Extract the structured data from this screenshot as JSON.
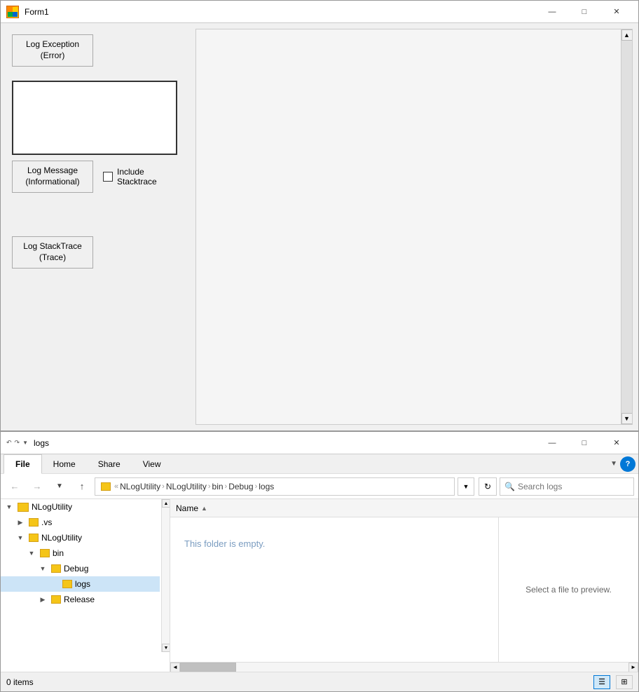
{
  "form1": {
    "title": "Form1",
    "buttons": {
      "log_exception": "Log Exception\n(Error)",
      "log_message": "Log Message\n(Informational)",
      "log_stacktrace": "Log StackTrace\n(Trace)"
    },
    "checkbox": {
      "label": "Include\nStacktrace",
      "checked": false
    },
    "textarea_placeholder": "",
    "window_controls": {
      "minimize": "—",
      "maximize": "□",
      "close": "✕"
    }
  },
  "explorer": {
    "title": "logs",
    "window_controls": {
      "minimize": "—",
      "maximize": "□",
      "close": "✕"
    },
    "ribbon": {
      "tabs": [
        "File",
        "Home",
        "Share",
        "View"
      ],
      "active_tab": "File"
    },
    "address_bar": {
      "path_segments": [
        "NLogUtility",
        "NLogUtility",
        "bin",
        "Debug",
        "logs"
      ],
      "search_placeholder": "Search logs"
    },
    "sidebar": {
      "items": [
        {
          "label": "NLogUtility",
          "level": 0,
          "expanded": true,
          "selected": false
        },
        {
          "label": ".vs",
          "level": 1,
          "expanded": false,
          "selected": false
        },
        {
          "label": "NLogUtility",
          "level": 1,
          "expanded": true,
          "selected": false
        },
        {
          "label": "bin",
          "level": 2,
          "expanded": true,
          "selected": false
        },
        {
          "label": "Debug",
          "level": 3,
          "expanded": true,
          "selected": false
        },
        {
          "label": "logs",
          "level": 4,
          "expanded": false,
          "selected": true
        },
        {
          "label": "Release",
          "level": 3,
          "expanded": false,
          "selected": false
        }
      ]
    },
    "main": {
      "column_header": "Name",
      "sort_indicator": "▲",
      "empty_message": "This folder is empty.",
      "preview_text": "Select a file to preview."
    },
    "statusbar": {
      "items_count": "0 items"
    }
  },
  "icons": {
    "folder": "📁",
    "back": "←",
    "forward": "→",
    "up": "↑",
    "recent": "⌄",
    "refresh": "↻",
    "search": "🔍",
    "help": "?",
    "expand": "▶",
    "collapse": "▼",
    "details_view": "☰",
    "large_icon_view": "⊞"
  }
}
